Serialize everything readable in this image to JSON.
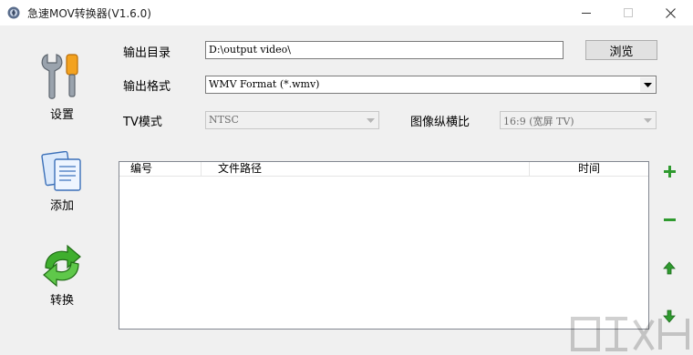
{
  "window": {
    "title": "急速MOV转换器(V1.6.0)",
    "min_glyph": "—",
    "max_glyph": "☐",
    "close_glyph": "✕"
  },
  "sidebar": {
    "settings_label": "设置",
    "add_label": "添加",
    "convert_label": "转换",
    "settings_icon": "tools-icon",
    "add_icon": "documents-icon",
    "convert_icon": "convert-arrows-icon"
  },
  "form": {
    "output_dir_label": "输出目录",
    "output_dir_value": "D:\\output video\\",
    "browse_label": "浏览",
    "output_format_label": "输出格式",
    "output_format_value": "WMV Format (*.wmv)",
    "tv_mode_label": "TV模式",
    "tv_mode_value": "NTSC",
    "aspect_label": "图像纵横比",
    "aspect_value": "16:9  (宽屏 TV)"
  },
  "file_list": {
    "columns": [
      "编号",
      "文件路径",
      "时间"
    ],
    "rows": []
  },
  "list_actions": {
    "add_icon": "plus-icon",
    "remove_icon": "minus-icon",
    "up_icon": "arrow-up-icon",
    "down_icon": "arrow-down-icon"
  },
  "colors": {
    "action_green": "#2f9a2f",
    "title_bar": "#ffffff",
    "window_bg": "#f0f0f0"
  }
}
